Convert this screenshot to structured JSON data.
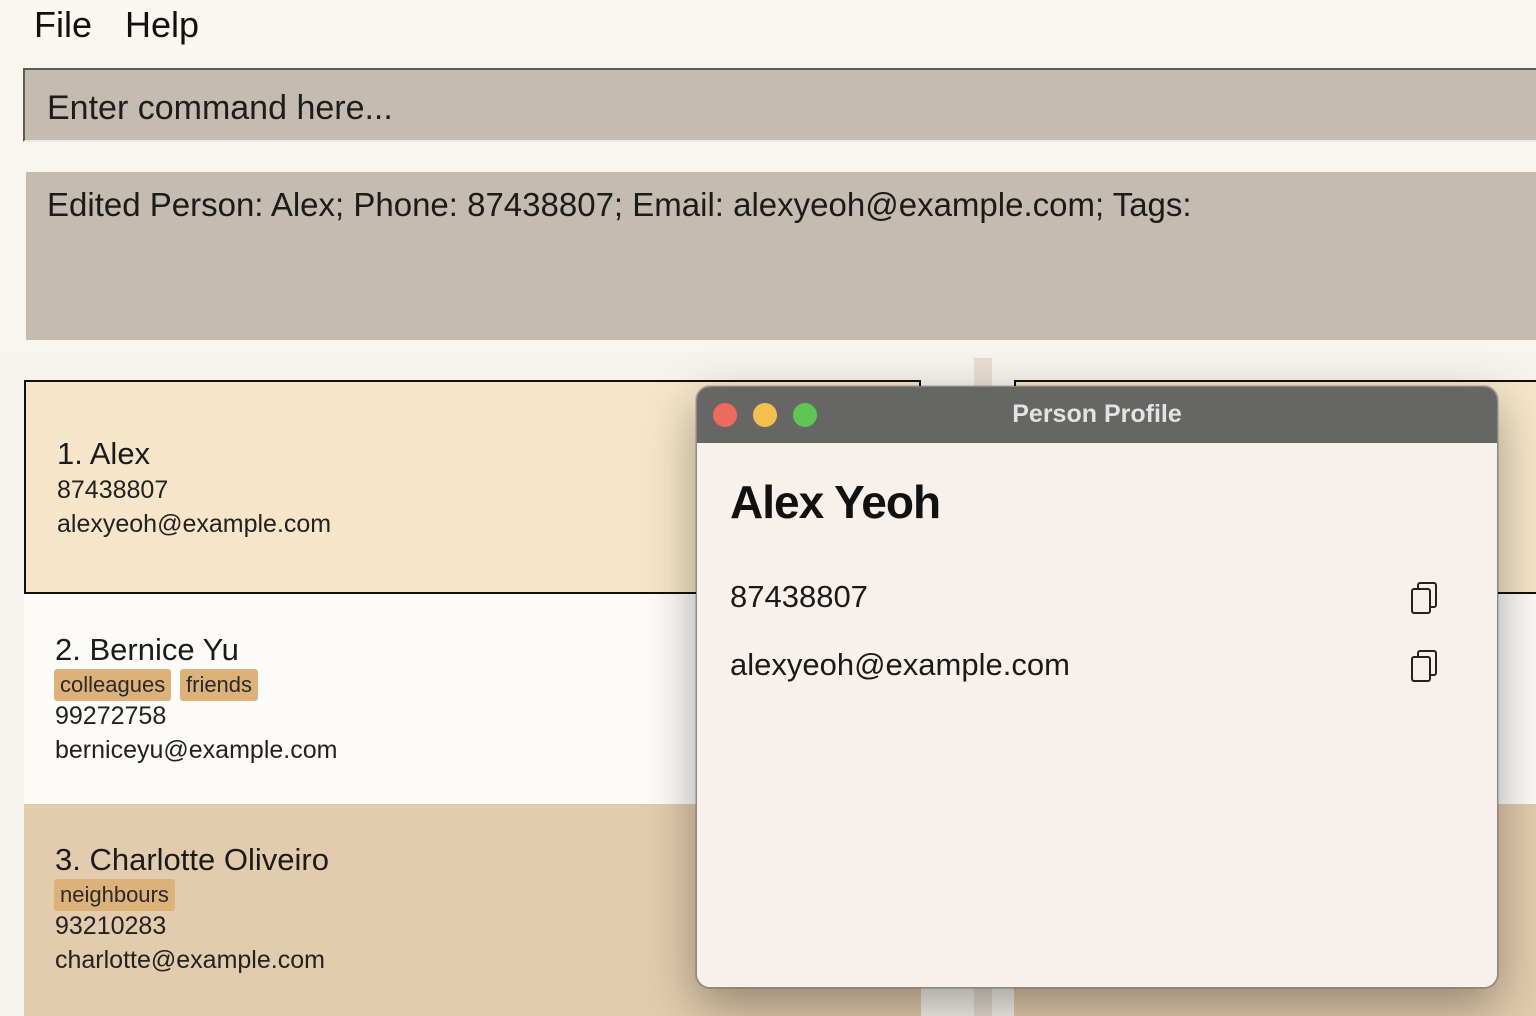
{
  "menu": {
    "file": "File",
    "help": "Help"
  },
  "command": {
    "placeholder": "Enter command here..."
  },
  "result": {
    "message": "Edited Person: Alex; Phone: 87438807; Email: alexyeoh@example.com; Tags:"
  },
  "persons": [
    {
      "title": "1. Alex",
      "phone": "87438807",
      "email": "alexyeoh@example.com",
      "tags": []
    },
    {
      "title": "2. Bernice Yu",
      "phone": "99272758",
      "email": "berniceyu@example.com",
      "tags": [
        "colleagues",
        "friends"
      ]
    },
    {
      "title": "3. Charlotte Oliveiro",
      "phone": "93210283",
      "email": "charlotte@example.com",
      "tags": [
        "neighbours"
      ]
    }
  ],
  "profile_window": {
    "title": "Person Profile",
    "name": "Alex Yeoh",
    "phone": "87438807",
    "email": "alexyeoh@example.com",
    "copy_icon": "copy-icon"
  },
  "colors": {
    "command_bg": "#c4bcb0",
    "selected_card": "#f6e5c8",
    "tag_bg": "#dcb27a",
    "card_alt": "#e3cbad",
    "titlebar": "#666664"
  }
}
